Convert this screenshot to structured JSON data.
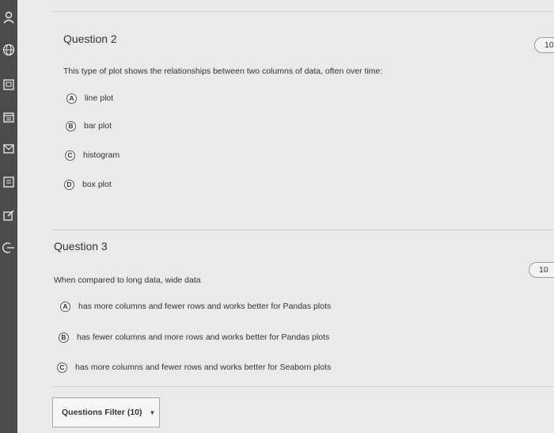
{
  "sidebar": {
    "icons": [
      "user-icon",
      "globe-icon",
      "book-icon",
      "calendar-icon",
      "inbox-icon",
      "courses-icon",
      "edit-icon",
      "logout-icon"
    ]
  },
  "questions": [
    {
      "title": "Question 2",
      "points": "10",
      "prompt": "This type of plot shows the relationships between two columns of data, often over time:",
      "options": [
        {
          "letter": "A",
          "text": "line plot"
        },
        {
          "letter": "B",
          "text": "bar plot"
        },
        {
          "letter": "C",
          "text": "histogram"
        },
        {
          "letter": "D",
          "text": "box plot"
        }
      ]
    },
    {
      "title": "Question 3",
      "points": "10",
      "prompt": "When compared to long data, wide data",
      "options": [
        {
          "letter": "A",
          "text": "has more columns and fewer rows and works better for Pandas plots"
        },
        {
          "letter": "B",
          "text": "has fewer columns and more rows and works better for Pandas plots"
        },
        {
          "letter": "C",
          "text": "has more columns and fewer rows and works better for Seaborn plots"
        }
      ]
    }
  ],
  "footer": {
    "filter_label": "Questions Filter (10)"
  }
}
